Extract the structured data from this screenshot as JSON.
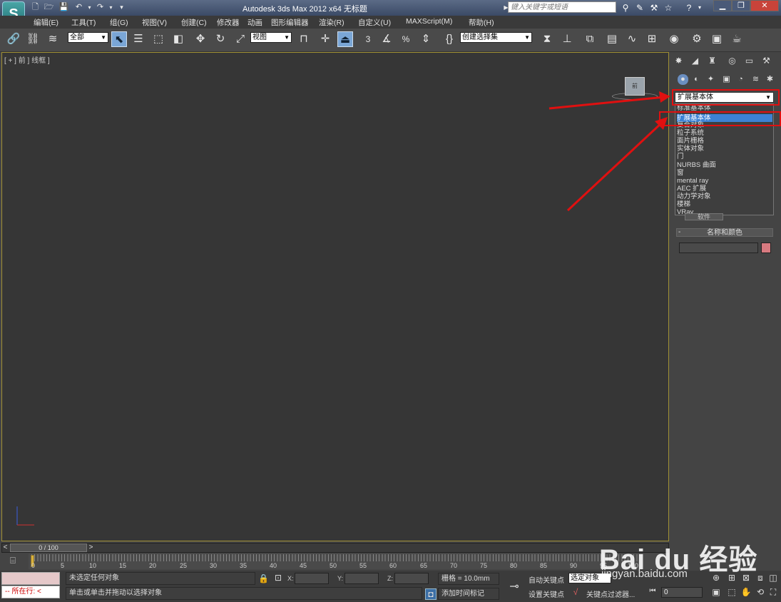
{
  "window": {
    "title": "Autodesk 3ds Max  2012 x64      无标题",
    "app_logo": "S",
    "search_placeholder": "键入关键字或短语"
  },
  "menubar": {
    "items": [
      "编辑(E)",
      "工具(T)",
      "组(G)",
      "视图(V)",
      "创建(C)",
      "修改器",
      "动画",
      "图形编辑器",
      "渲染(R)",
      "自定义(U)",
      "MAXScript(M)",
      "帮助(H)"
    ]
  },
  "toolbar": {
    "selection_filter": "全部",
    "reference_coord": "视图",
    "named_selection_set": "创建选择集",
    "snap_labels": [
      "3",
      "%"
    ]
  },
  "viewport": {
    "label": "[ + ] 前 ] 线框 ]",
    "viewcube_label": "前"
  },
  "command_panel": {
    "category_selected": "扩展基本体",
    "dropdown_items": [
      "标准基本体",
      "扩展基本体",
      "复合对象",
      "粒子系统",
      "面片栅格",
      "实体对象",
      "门",
      "NURBS 曲面",
      "窗",
      "mental ray",
      "AEC 扩展",
      "动力学对象",
      "楼梯",
      "VRay"
    ],
    "dropdown_selected_index": 1,
    "partial_button": "软件",
    "rollout_title": "名称和颜色",
    "object_color": "#d87a80"
  },
  "timeline": {
    "slider_label": "0 / 100",
    "ticks": [
      "0",
      "5",
      "10",
      "15",
      "20",
      "25",
      "30",
      "35",
      "40",
      "45",
      "50",
      "55",
      "60",
      "65",
      "70",
      "75",
      "80",
      "85",
      "90",
      "95",
      "100"
    ]
  },
  "statusbar": {
    "mini_listener": "所在行:",
    "status_line_1": "未选定任何对象",
    "status_line_2": "单击或单击并拖动以选择对象",
    "x_label": "X:",
    "y_label": "Y:",
    "z_label": "Z:",
    "grid": "栅格 = 10.0mm",
    "add_time_tag": "添加时间标记",
    "auto_key": "自动关键点",
    "set_key": "设置关键点",
    "selected_object": "选定对象",
    "key_filters": "关键点过滤器...",
    "current_frame": "0"
  },
  "watermark": {
    "brand": "Bai du 经验",
    "url": "jingyan.baidu.com"
  },
  "colors": {
    "annotation_red": "#e01010",
    "selection_blue": "#3c82d4",
    "viewport_bg": "#363636",
    "active_viewport_border": "#a09034"
  }
}
